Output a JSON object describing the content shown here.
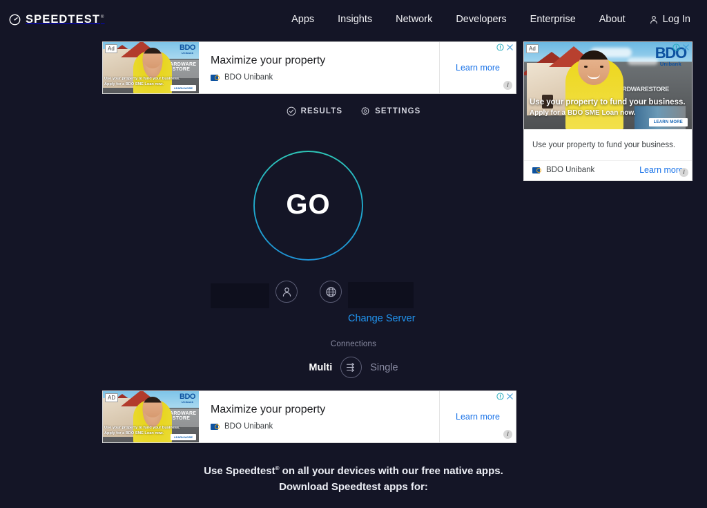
{
  "header": {
    "brand": "SPEEDTEST",
    "brand_icon": "speedometer-icon",
    "nav": [
      {
        "label": "Apps"
      },
      {
        "label": "Insights"
      },
      {
        "label": "Network"
      },
      {
        "label": "Developers"
      },
      {
        "label": "Enterprise"
      },
      {
        "label": "About"
      }
    ],
    "login_label": "Log In",
    "login_icon": "person-icon",
    "background": "#141526"
  },
  "tabs": [
    {
      "label": "RESULTS",
      "icon": "check-circle-icon"
    },
    {
      "label": "SETTINGS",
      "icon": "gear-icon"
    }
  ],
  "go_button": {
    "label": "GO",
    "ring_color_top": "#2ec6b8",
    "ring_color_bottom": "#1f93d6"
  },
  "connection": {
    "isp_value": "",
    "server_value": "",
    "isp_icon": "person-icon",
    "server_icon": "globe-icon",
    "change_server_label": "Change Server",
    "change_server_color": "#2196f3"
  },
  "connections_toggle": {
    "label": "Connections",
    "multi_label": "Multi",
    "single_label": "Single",
    "selected": "Multi",
    "icon": "multi-arrows-icon"
  },
  "footer": {
    "line1_prefix": "Use Speedtest",
    "line1_suffix": " on all your devices with our free native apps.",
    "line2": "Download Speedtest apps for:"
  },
  "ads": {
    "top_banner": {
      "ad_label": "Ad",
      "headline": "Maximize your property",
      "advertiser": "BDO Unibank",
      "cta": "Learn more",
      "info_icon": "info-circle-icon",
      "close_icon": "close-x-icon",
      "corner_icon": "info-dot-icon",
      "creative": {
        "brand": "BDO",
        "brand_sub": "Unibank",
        "store_sign": "HARDWARE STORE",
        "overlay_line1": "Use your property to fund your business.",
        "overlay_line2": "Apply for a BDO SME Loan now.",
        "overlay_button": "LEARN MORE"
      }
    },
    "bottom_banner": {
      "ad_label": "AD",
      "headline": "Maximize your property",
      "advertiser": "BDO Unibank",
      "cta": "Learn more",
      "info_icon": "info-circle-icon",
      "close_icon": "close-x-icon",
      "corner_icon": "info-dot-icon",
      "creative": {
        "brand": "BDO",
        "brand_sub": "Unibank",
        "store_sign": "HARDWARE STORE",
        "overlay_line1": "Use your property to fund your business.",
        "overlay_line2": "Apply for a BDO SME Loan now.",
        "overlay_button": "LEARN MORE"
      }
    },
    "side_rect": {
      "ad_label": "Ad",
      "description": "Use your property to fund your business.",
      "advertiser": "BDO Unibank",
      "cta": "Learn more",
      "info_icon": "info-circle-icon",
      "close_icon": "close-x-icon",
      "corner_icon": "info-dot-icon",
      "creative": {
        "brand": "BDO",
        "brand_sub": "Unibank",
        "store_sign": "HARDWARE",
        "store_sign_small": "STORE",
        "overlay_line1": "Use your property to fund your business.",
        "overlay_line2": "Apply for a BDO SME Loan now.",
        "overlay_button": "LEARN MORE"
      }
    }
  }
}
